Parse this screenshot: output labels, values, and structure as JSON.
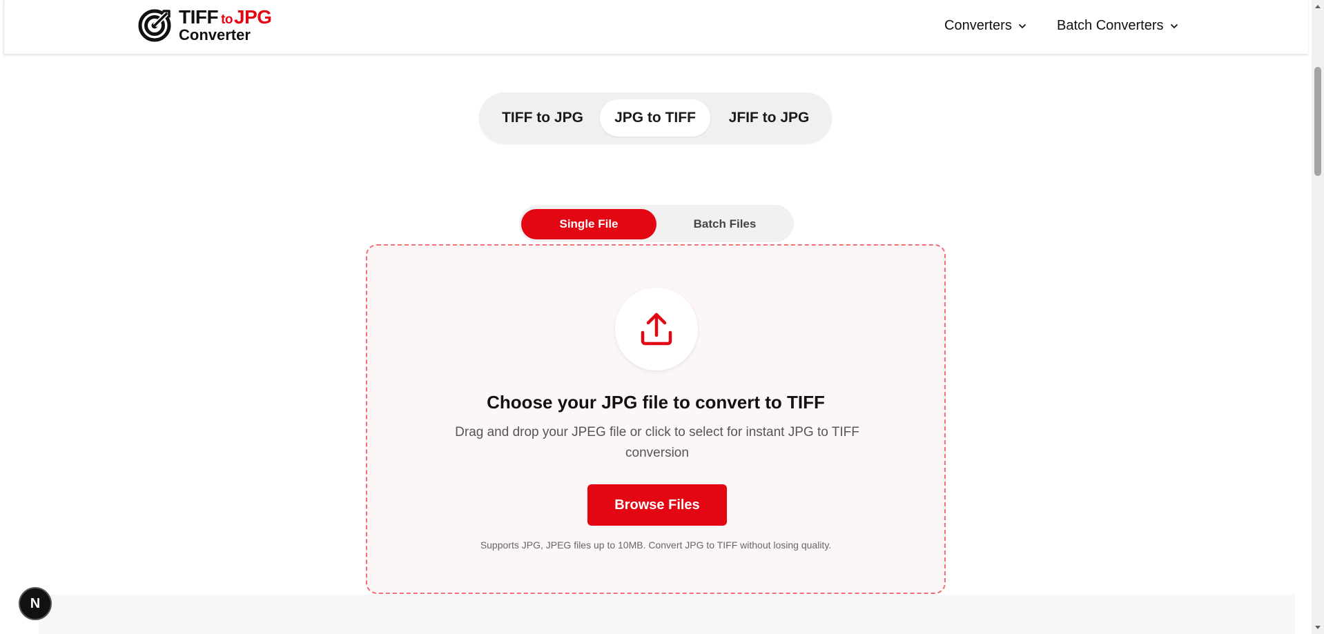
{
  "header": {
    "logo": {
      "line1_part1": "TIFF",
      "line1_to": "to",
      "line1_part2": "JPG",
      "line2": "Converter"
    },
    "nav": [
      {
        "label": "Converters",
        "icon": "chevron-down-icon"
      },
      {
        "label": "Batch Converters",
        "icon": "chevron-down-icon"
      }
    ]
  },
  "converter_tabs": [
    {
      "label": "TIFF to JPG",
      "active": false
    },
    {
      "label": "JPG to TIFF",
      "active": true
    },
    {
      "label": "JFIF to JPG",
      "active": false
    }
  ],
  "mode_toggle": [
    {
      "label": "Single File",
      "active": true
    },
    {
      "label": "Batch Files",
      "active": false
    }
  ],
  "dropzone": {
    "icon": "upload-icon",
    "title": "Choose your JPG file to convert to TIFF",
    "description": "Drag and drop your JPEG file or click to select for instant JPG to TIFF conversion",
    "button_label": "Browse Files",
    "note": "Supports JPG, JPEG files up to 10MB. Convert JPG to TIFF without losing quality."
  },
  "badge": {
    "label": "N"
  },
  "colors": {
    "accent": "#e30613",
    "dropzone_border": "#f26d76",
    "dropzone_bg": "#fdf6f6"
  }
}
